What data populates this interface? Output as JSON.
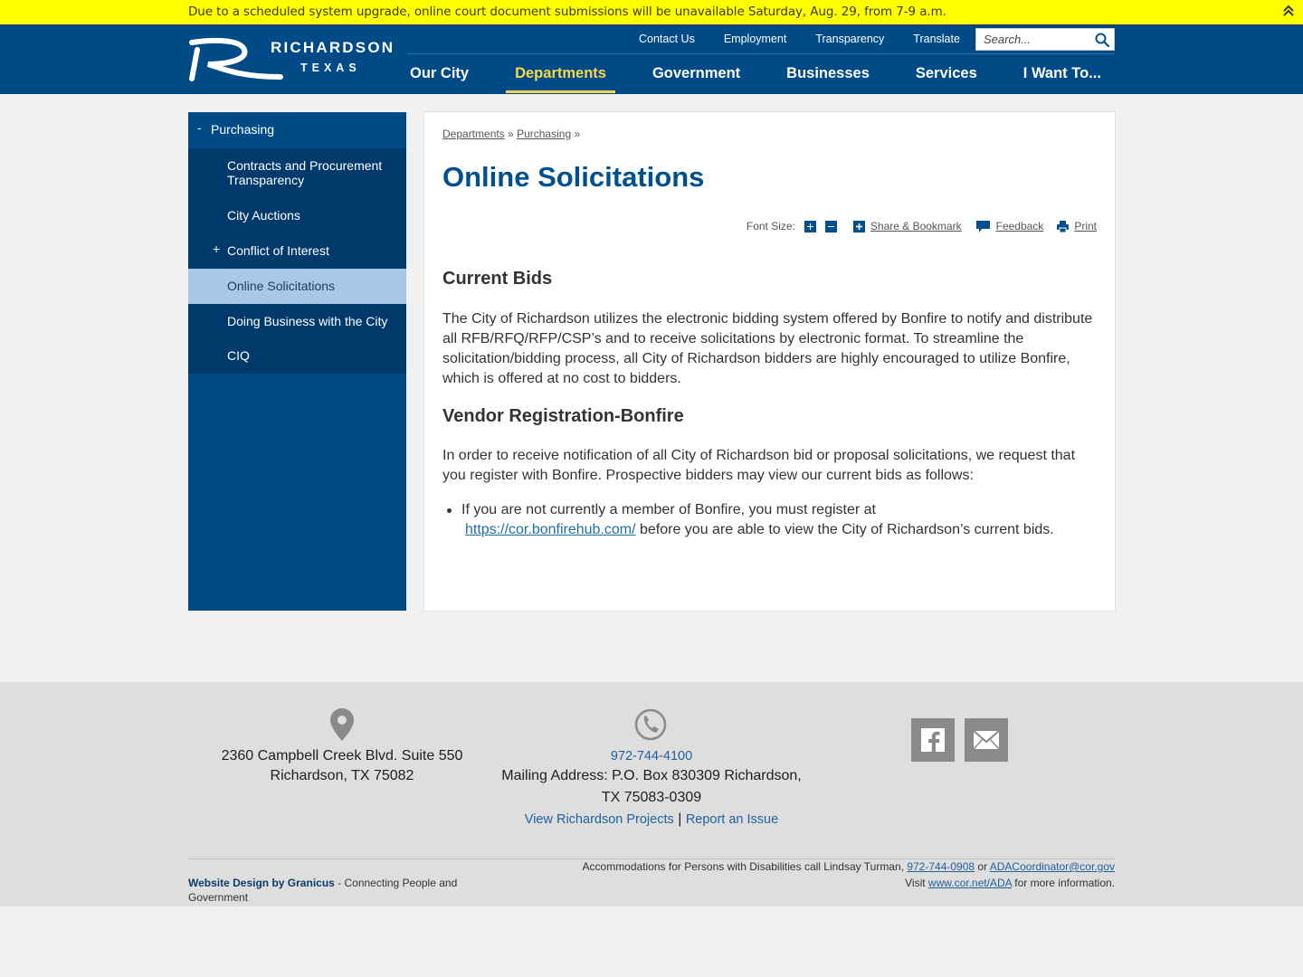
{
  "alert": {
    "text": "Due to a scheduled system upgrade, online court document submissions will be unavailable Saturday, Aug. 29, from 7-9 a.m."
  },
  "logo": {
    "name": "RICHARDSON",
    "state": "TEXAS"
  },
  "utility_links": [
    "Contact Us",
    "Employment",
    "Transparency",
    "Translate"
  ],
  "search": {
    "placeholder": "Search..."
  },
  "main_nav": [
    {
      "label": "Our City",
      "active": false
    },
    {
      "label": "Departments",
      "active": true
    },
    {
      "label": "Government",
      "active": false
    },
    {
      "label": "Businesses",
      "active": false
    },
    {
      "label": "Services",
      "active": false
    },
    {
      "label": "I Want To...",
      "active": false
    }
  ],
  "sidebar": {
    "parent": {
      "toggle": "-",
      "label": "Purchasing"
    },
    "items": [
      {
        "label": "Contracts and Procurement Transparency"
      },
      {
        "label": "City Auctions"
      },
      {
        "label": "Conflict of Interest",
        "toggle": "+"
      },
      {
        "label": "Online Solicitations",
        "current": true
      },
      {
        "label": "Doing Business with the City"
      },
      {
        "label": "CIQ"
      }
    ]
  },
  "breadcrumb": {
    "items": [
      "Departments",
      "Purchasing"
    ],
    "separator": "»"
  },
  "page_title": "Online Solicitations",
  "tools": {
    "font_size_label": "Font Size:",
    "share_label": "Share & Bookmark",
    "feedback_label": "Feedback",
    "print_label": "Print"
  },
  "content": {
    "heading1": "Current Bids",
    "para1": "The City of Richardson utilizes the electronic bidding system offered by Bonfire to notify and distribute all RFB/RFQ/RFP/CSP’s and to receive solicitations by electronic format. To streamline the solicitation/bidding process, all City of Richardson bidders are highly encouraged to utilize Bonfire, which is offered at no cost to bidders.",
    "heading2": "Vendor Registration-Bonfire",
    "para2": "In order to receive notification of all City of Richardson bid or proposal solicitations, we request that you register with Bonfire. Prospective bidders may view our current bids as follows:",
    "bullet_pre": "If you are not currently a member of Bonfire, you must register at",
    "bullet_link": "https://cor.bonfirehub.com/",
    "bullet_post": " before you are able to view the City of Richardson’s current bids."
  },
  "footer": {
    "address_line1": "2360 Campbell Creek Blvd. Suite 550",
    "address_line2": "Richardson, TX 75082",
    "phone": "972-744-4100",
    "mailing_line1": "Mailing Address: P.O. Box 830309 Richardson,",
    "mailing_line2": "TX 75083-0309",
    "projects_link": "View Richardson Projects",
    "link_separator": "|",
    "report_link": "Report an Issue",
    "credit_link": "Website Design by Granicus",
    "credit_text": " - Connecting People and Government",
    "ada_text1": "Accommodations for Persons with Disabilities call Lindsay Turman, ",
    "ada_phone": "972-744-0908",
    "ada_or": " or ",
    "ada_email": "ADACoordinator@cor.gov",
    "ada_visit": "Visit ",
    "ada_site": "www.cor.net/ADA",
    "ada_more": " for more information."
  },
  "colors": {
    "alert_bg": "#ffff00",
    "header_bg": "#004b87",
    "nav_active": "#f6d64a",
    "sidebar_current": "#a9c8e8",
    "title": "#00508f",
    "footer_bg": "#dedede"
  }
}
